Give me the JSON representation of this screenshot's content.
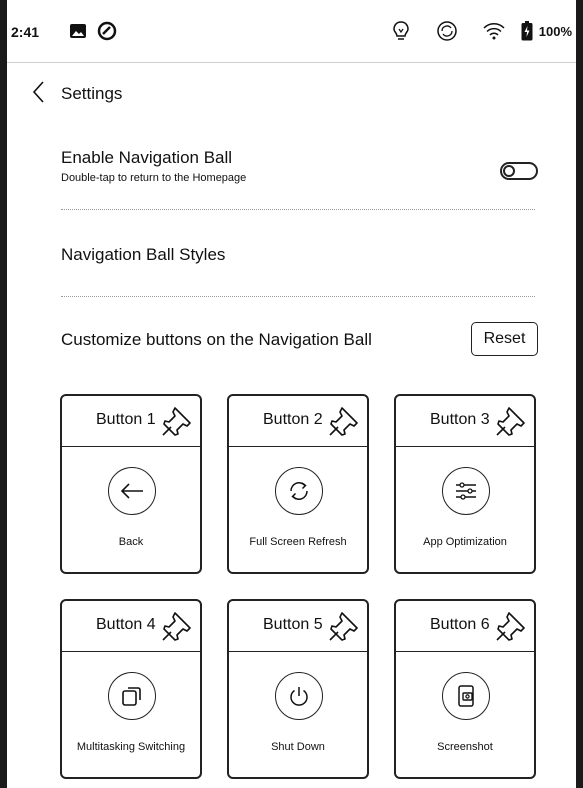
{
  "status": {
    "time": "2:41",
    "battery": "100%"
  },
  "header": {
    "title": "Settings"
  },
  "settings": {
    "enable_nav_ball": {
      "title": "Enable Navigation Ball",
      "subtitle": "Double-tap to return to the Homepage",
      "enabled": false
    },
    "nav_ball_styles": {
      "title": "Navigation Ball Styles"
    },
    "customize": {
      "title": "Customize buttons on the Navigation Ball",
      "reset_label": "Reset"
    }
  },
  "buttons": [
    {
      "label": "Button 1",
      "action": "Back",
      "icon": "back-arrow-icon"
    },
    {
      "label": "Button 2",
      "action": "Full Screen Refresh",
      "icon": "refresh-icon"
    },
    {
      "label": "Button 3",
      "action": "App Optimization",
      "icon": "sliders-icon"
    },
    {
      "label": "Button 4",
      "action": "Multitasking Switching",
      "icon": "multitask-icon"
    },
    {
      "label": "Button 5",
      "action": "Shut Down",
      "icon": "power-icon"
    },
    {
      "label": "Button 6",
      "action": "Screenshot",
      "icon": "screenshot-icon"
    }
  ]
}
